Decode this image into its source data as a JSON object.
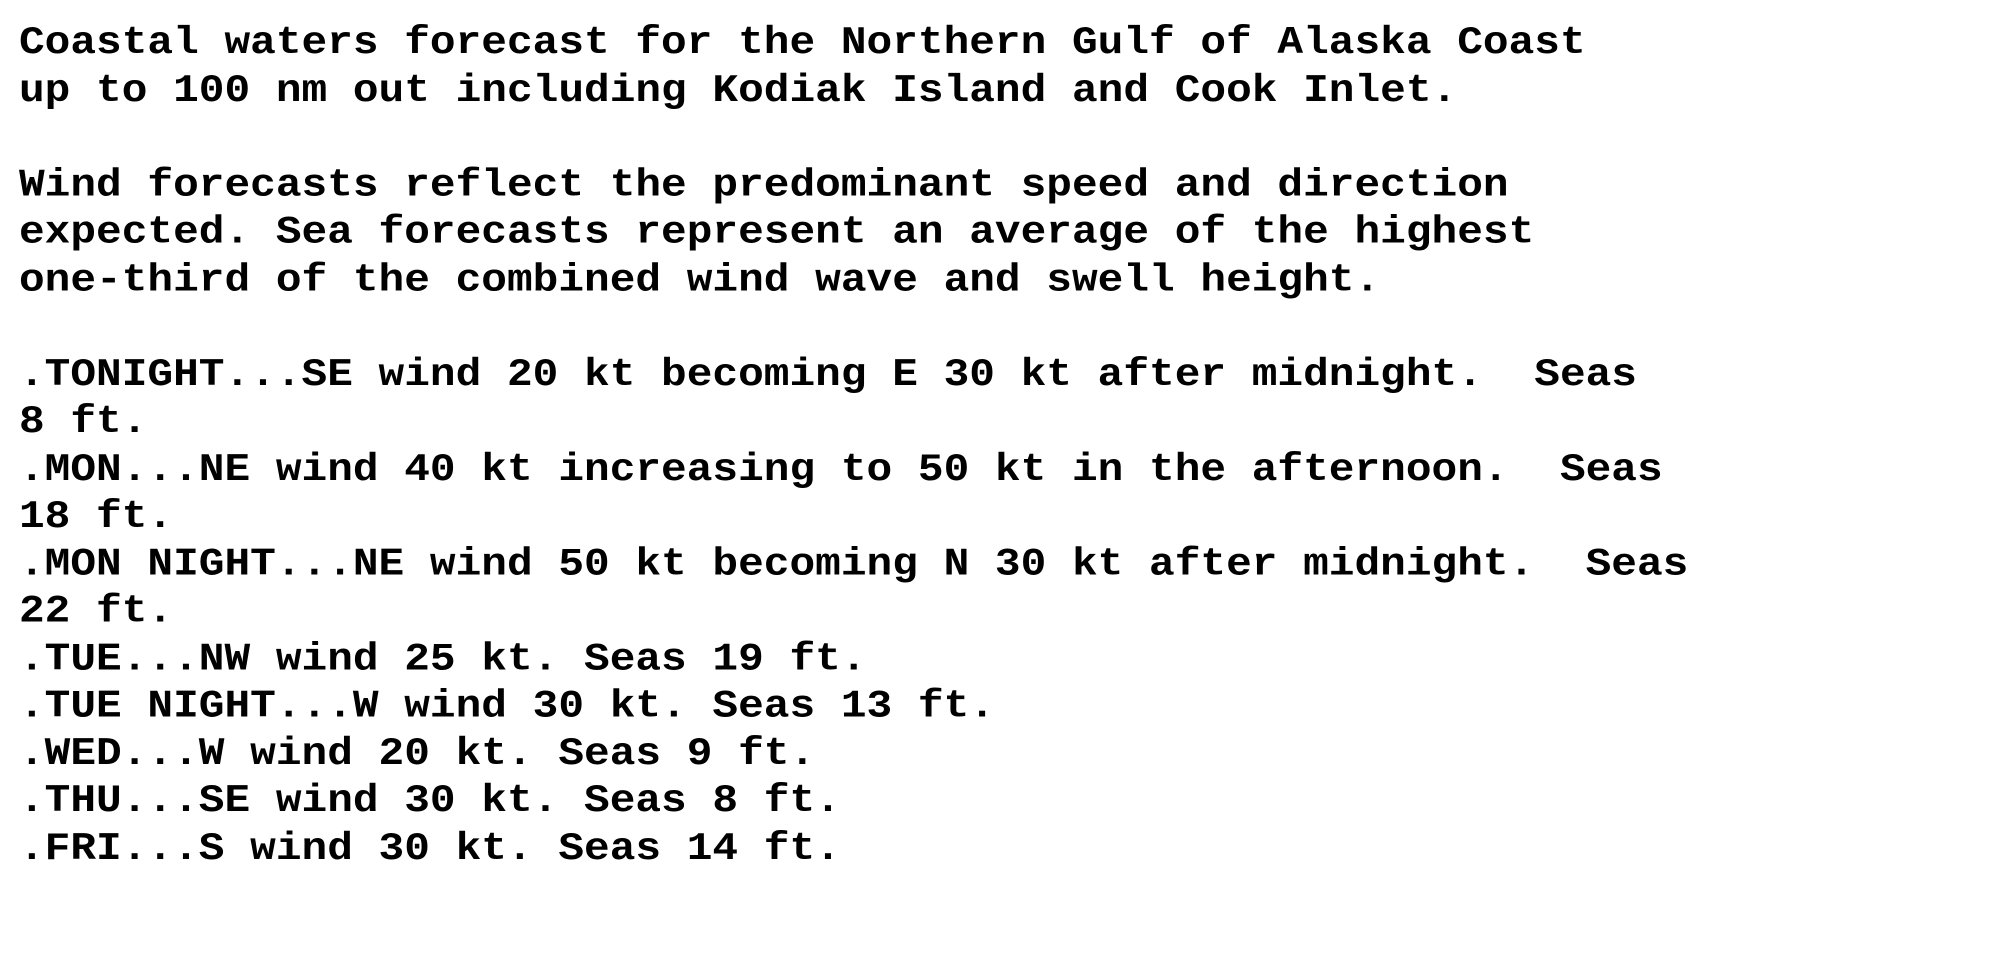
{
  "document": {
    "header_lines": [
      "Coastal waters forecast for the Northern Gulf of Alaska Coast",
      "up to 100 nm out including Kodiak Island and Cook Inlet."
    ],
    "note_lines": [
      "Wind forecasts reflect the predominant speed and direction",
      "expected. Sea forecasts represent an average of the highest",
      "one-third of the combined wind wave and swell height."
    ],
    "forecast_lines": [
      ".TONIGHT...SE wind 20 kt becoming E 30 kt after midnight.  Seas",
      "8 ft.",
      ".MON...NE wind 40 kt increasing to 50 kt in the afternoon.  Seas",
      "18 ft.",
      ".MON NIGHT...NE wind 50 kt becoming N 30 kt after midnight.  Seas",
      "22 ft.",
      ".TUE...NW wind 25 kt. Seas 19 ft.",
      ".TUE NIGHT...W wind 30 kt. Seas 13 ft.",
      ".WED...W wind 20 kt. Seas 9 ft.",
      ".THU...SE wind 30 kt. Seas 8 ft.",
      ".FRI...S wind 30 kt. Seas 14 ft."
    ]
  },
  "forecast_periods": [
    {
      "period": "TONIGHT",
      "wind": "SE wind 20 kt becoming E 30 kt after midnight",
      "seas_ft": 8
    },
    {
      "period": "MON",
      "wind": "NE wind 40 kt increasing to 50 kt in the afternoon",
      "seas_ft": 18
    },
    {
      "period": "MON NIGHT",
      "wind": "NE wind 50 kt becoming N 30 kt after midnight",
      "seas_ft": 22
    },
    {
      "period": "TUE",
      "wind": "NW wind 25 kt",
      "seas_ft": 19
    },
    {
      "period": "TUE NIGHT",
      "wind": "W wind 30 kt",
      "seas_ft": 13
    },
    {
      "period": "WED",
      "wind": "W wind 20 kt",
      "seas_ft": 9
    },
    {
      "period": "THU",
      "wind": "SE wind 30 kt",
      "seas_ft": 8
    },
    {
      "period": "FRI",
      "wind": "S wind 30 kt",
      "seas_ft": 14
    }
  ]
}
